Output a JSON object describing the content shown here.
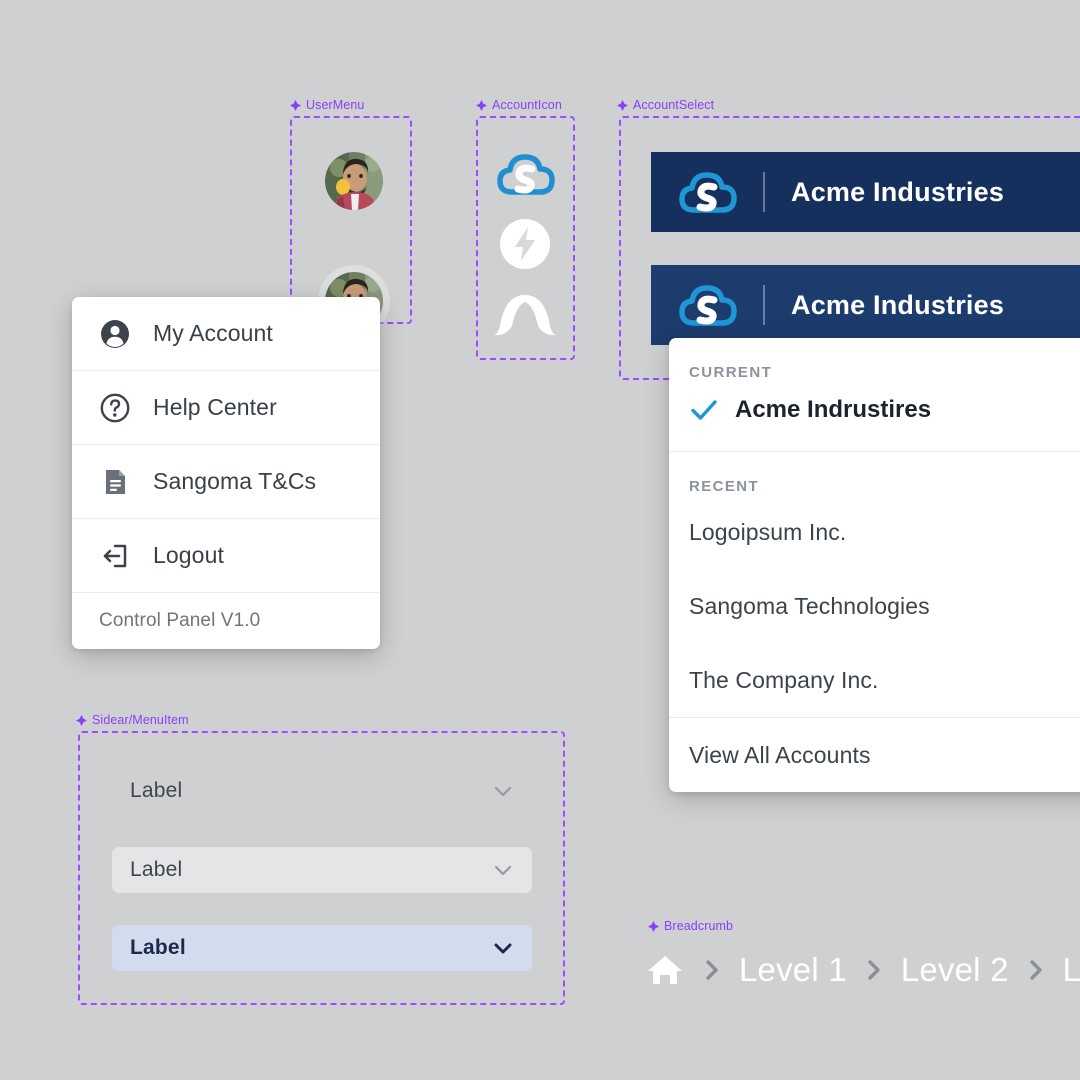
{
  "canvas": {
    "background_color": "#cfd0d1",
    "annotation_color": "#8a3ffc"
  },
  "annotations": [
    {
      "name": "UserMenu"
    },
    {
      "name": "AccountIcon"
    },
    {
      "name": "AccountSelect"
    },
    {
      "name": "Sidear/MenuItem"
    },
    {
      "name": "Breadcrumb"
    }
  ],
  "user_menu": {
    "avatars": [
      {
        "icon": "user-avatar-photo",
        "state": "default"
      },
      {
        "icon": "user-avatar-photo",
        "state": "hovered"
      }
    ],
    "items": [
      {
        "icon": "person-circle-icon",
        "label": "My Account"
      },
      {
        "icon": "question-circle-icon",
        "label": "Help Center"
      },
      {
        "icon": "document-icon",
        "label": "Sangoma T&Cs"
      },
      {
        "icon": "logout-icon",
        "label": "Logout"
      }
    ],
    "version": "Control Panel V1.0"
  },
  "account_icons": [
    {
      "icon": "sangoma-cloud-s-icon",
      "color": "#1f8fd0"
    },
    {
      "icon": "lightning-bolt-circle-icon",
      "color": "#ffffff"
    },
    {
      "icon": "arch-wing-icon",
      "color": "#ffffff"
    }
  ],
  "account_select": {
    "bars": [
      {
        "logo": "sangoma-cloud-s-icon",
        "name": "Acme Industries",
        "state": "default",
        "background_color": "#15305c"
      },
      {
        "logo": "sangoma-cloud-s-icon",
        "name": "Acme Industries",
        "state": "hover",
        "background_color": "#1d3c6e"
      }
    ]
  },
  "account_dropdown": {
    "current_heading": "CURRENT",
    "current_account": "Acme Indrustires",
    "current_check_icon": "check-icon",
    "current_check_color": "#2196d6",
    "recent_heading": "RECENT",
    "recent_accounts": [
      "Logoipsum Inc.",
      "Sangoma Technologies",
      "The Company Inc."
    ],
    "view_all_label": "View All Accounts"
  },
  "sidebar_menu": {
    "items": [
      {
        "label": "Label",
        "state": "default",
        "chevron_icon": "chevron-down-icon"
      },
      {
        "label": "Label",
        "state": "hover",
        "chevron_icon": "chevron-down-icon"
      },
      {
        "label": "Label",
        "state": "active",
        "chevron_icon": "chevron-down-icon"
      }
    ]
  },
  "breadcrumb": {
    "home_icon": "home-icon",
    "separator_icon": "chevron-right-icon",
    "levels": [
      "Level 1",
      "Level 2",
      "Lev"
    ]
  }
}
